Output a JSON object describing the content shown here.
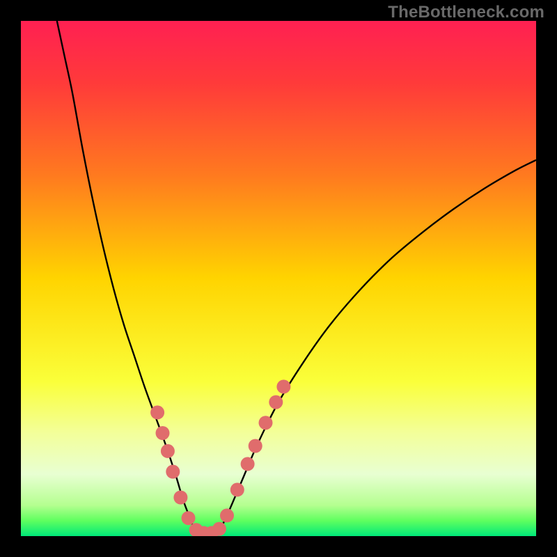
{
  "watermark": "TheBottleneck.com",
  "chart_data": {
    "type": "line",
    "title": "",
    "xlabel": "",
    "ylabel": "",
    "xlim": [
      0,
      100
    ],
    "ylim": [
      0,
      100
    ],
    "gradient_stops": [
      {
        "offset": 0.0,
        "color": "#ff2052"
      },
      {
        "offset": 0.12,
        "color": "#ff3a3a"
      },
      {
        "offset": 0.3,
        "color": "#ff7a1f"
      },
      {
        "offset": 0.5,
        "color": "#ffd400"
      },
      {
        "offset": 0.7,
        "color": "#faff3a"
      },
      {
        "offset": 0.8,
        "color": "#f3ff9a"
      },
      {
        "offset": 0.88,
        "color": "#e8ffd2"
      },
      {
        "offset": 0.94,
        "color": "#b5ff90"
      },
      {
        "offset": 0.97,
        "color": "#5fff5f"
      },
      {
        "offset": 1.0,
        "color": "#00e879"
      }
    ],
    "series": [
      {
        "name": "left-curve",
        "type": "line",
        "x": [
          7,
          8.5,
          10,
          12,
          14,
          16,
          18,
          20,
          22,
          24,
          26,
          28,
          30,
          31.5,
          33,
          34
        ],
        "y": [
          100,
          93,
          86,
          75,
          65,
          56,
          48,
          41,
          35,
          29,
          23.5,
          18,
          12,
          7,
          3,
          0
        ]
      },
      {
        "name": "right-curve",
        "type": "line",
        "x": [
          38,
          40,
          43,
          46,
          50,
          55,
          60,
          66,
          72,
          78,
          84,
          90,
          96,
          100
        ],
        "y": [
          0,
          4,
          11,
          18,
          26,
          34,
          41,
          48,
          54,
          59,
          63.5,
          67.5,
          71,
          73
        ]
      }
    ],
    "markers": {
      "name": "highlight-dots",
      "color": "#e06c6c",
      "radius_px": 10,
      "points": [
        {
          "x": 26.5,
          "y": 24
        },
        {
          "x": 27.5,
          "y": 20
        },
        {
          "x": 28.5,
          "y": 16.5
        },
        {
          "x": 29.5,
          "y": 12.5
        },
        {
          "x": 31.0,
          "y": 7.5
        },
        {
          "x": 32.5,
          "y": 3.5
        },
        {
          "x": 34.0,
          "y": 1.2
        },
        {
          "x": 35.5,
          "y": 0.6
        },
        {
          "x": 37.0,
          "y": 0.6
        },
        {
          "x": 38.5,
          "y": 1.4
        },
        {
          "x": 40.0,
          "y": 4.0
        },
        {
          "x": 42.0,
          "y": 9.0
        },
        {
          "x": 44.0,
          "y": 14.0
        },
        {
          "x": 45.5,
          "y": 17.5
        },
        {
          "x": 47.5,
          "y": 22.0
        },
        {
          "x": 49.5,
          "y": 26.0
        },
        {
          "x": 51.0,
          "y": 29.0
        }
      ]
    }
  }
}
